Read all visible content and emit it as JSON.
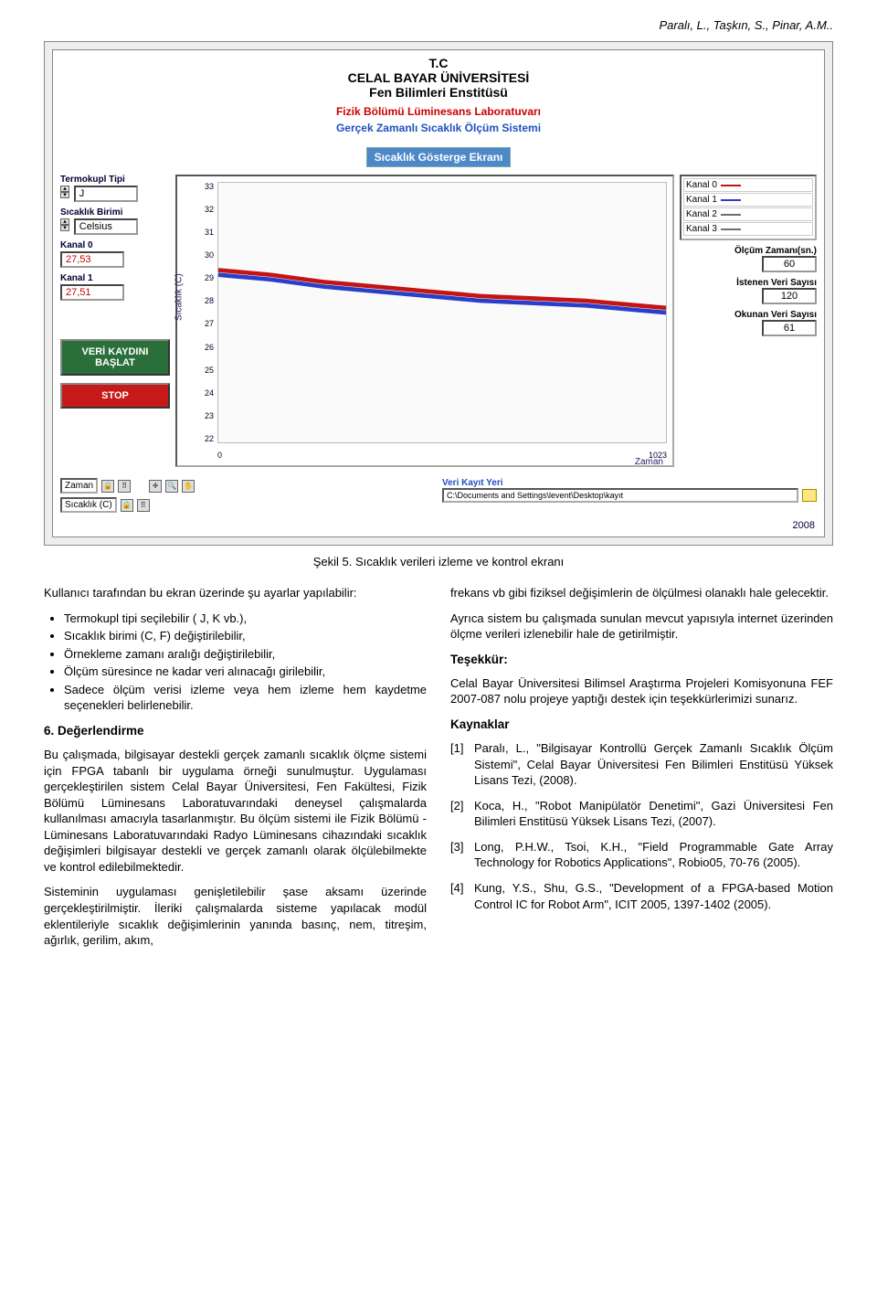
{
  "header": {
    "running": "Paralı, L., Taşkın, S., Pinar, A.M.."
  },
  "figure": {
    "header": {
      "line1a": "T.C",
      "line1b": "CELAL BAYAR ÜNİVERSİTESİ",
      "line1c": "Fen Bilimleri Enstitüsü",
      "line2": "Fizik Bölümü Lüminesans Laboratuvarı",
      "line3": "Gerçek Zamanlı Sıcaklık Ölçüm Sistemi"
    },
    "titlebar": "Sıcaklık Gösterge  Ekranı",
    "left": {
      "thermocouple_label": "Termokupl Tipi",
      "thermocouple_value": "J",
      "unit_label": "Sıcaklık Birimi",
      "unit_value": "Celsius",
      "ch0_label": "Kanal 0",
      "ch0_value": "27,53",
      "ch1_label": "Kanal 1",
      "ch1_value": "27,51",
      "start_btn": "VERİ KAYDINI BAŞLAT",
      "stop_btn": "STOP"
    },
    "graph": {
      "y_label": "Sıcaklık (C)",
      "y_ticks": [
        "33",
        "32",
        "31",
        "30",
        "29",
        "28",
        "27",
        "26",
        "25",
        "24",
        "23",
        "22"
      ],
      "x_ticks": [
        "0",
        "1023"
      ],
      "x_label": "Zaman"
    },
    "right": {
      "legend": [
        {
          "name": "Kanal 0",
          "color": "#c41414"
        },
        {
          "name": "Kanal 1",
          "color": "#2a3fc9"
        },
        {
          "name": "Kanal 2",
          "color": "#6e6e6e"
        },
        {
          "name": "Kanal 3",
          "color": "#6e6e6e"
        }
      ],
      "time_label": "Ölçüm Zamanı(sn.)",
      "time_value": "60",
      "wanted_label": "İstenen Veri Sayısı",
      "wanted_value": "120",
      "read_label": "Okunan Veri Sayısı",
      "read_value": "61"
    },
    "footer": {
      "x_sel_label": "Zaman",
      "y_sel_label": "Sıcaklık (C)",
      "icon1": "🔒",
      "icon2": "⠿",
      "save_label": "Veri Kayıt Yeri",
      "save_path": "C:\\Documents and Settings\\levent\\Desktop\\kayıt",
      "year": "2008"
    },
    "caption": "Şekil 5. Sıcaklık verileri izleme ve kontrol ekranı"
  },
  "chart_data": {
    "type": "line",
    "title": "Sıcaklık Gösterge Ekranı",
    "xlabel": "Zaman",
    "ylabel": "Sıcaklık (C)",
    "xlim": [
      0,
      1023
    ],
    "ylim": [
      22,
      33
    ],
    "y_ticks": [
      22,
      23,
      24,
      25,
      26,
      27,
      28,
      29,
      30,
      31,
      32,
      33
    ],
    "series": [
      {
        "name": "Kanal 0",
        "color": "#c41414",
        "values_approx": [
          [
            0,
            29.3
          ],
          [
            120,
            29.1
          ],
          [
            240,
            28.8
          ],
          [
            360,
            28.6
          ],
          [
            480,
            28.4
          ],
          [
            600,
            28.2
          ],
          [
            720,
            28.1
          ],
          [
            840,
            28.0
          ],
          [
            960,
            27.8
          ],
          [
            1023,
            27.7
          ]
        ]
      },
      {
        "name": "Kanal 1",
        "color": "#2a3fc9",
        "values_approx": [
          [
            0,
            29.1
          ],
          [
            120,
            28.9
          ],
          [
            240,
            28.6
          ],
          [
            360,
            28.4
          ],
          [
            480,
            28.2
          ],
          [
            600,
            28.0
          ],
          [
            720,
            27.9
          ],
          [
            840,
            27.8
          ],
          [
            960,
            27.6
          ],
          [
            1023,
            27.5
          ]
        ]
      }
    ]
  },
  "body": {
    "left": {
      "p1": "Kullanıcı tarafından bu ekran üzerinde şu ayarlar yapılabilir:",
      "li1": "Termokupl tipi seçilebilir ( J, K vb.),",
      "li2": "Sıcaklık birimi (C, F) değiştirilebilir,",
      "li3": "Örnekleme zamanı aralığı değiştirilebilir,",
      "li4": "Ölçüm süresince ne kadar veri alınacağı girilebilir,",
      "li5": "Sadece ölçüm verisi izleme veya hem izleme hem kaydetme seçenekleri belirlenebilir.",
      "h6": "6. Değerlendirme",
      "p2": "Bu çalışmada, bilgisayar destekli gerçek zamanlı sıcaklık ölçme sistemi için FPGA tabanlı bir uygulama örneği sunulmuştur. Uygulaması gerçekleştirilen sistem Celal Bayar Üniversitesi, Fen Fakültesi, Fizik Bölümü Lüminesans Laboratuvarındaki deneysel çalışmalarda kullanılması amacıyla tasarlanmıştır. Bu ölçüm sistemi ile Fizik Bölümü - Lüminesans Laboratuvarındaki Radyo Lüminesans cihazındaki sıcaklık değişimleri bilgisayar destekli ve gerçek zamanlı olarak ölçülebilmekte ve kontrol edilebilmektedir.",
      "p3": "Sisteminin uygulaması genişletilebilir şase aksamı üzerinde gerçekleştirilmiştir. İleriki çalışmalarda sisteme yapılacak modül eklentileriyle sıcaklık değişimlerinin yanında basınç, nem, titreşim, ağırlık, gerilim, akım,"
    },
    "right": {
      "p1": "frekans vb gibi fiziksel değişimlerin de ölçülmesi olanaklı hale gelecektir.",
      "p2": "Ayrıca sistem bu çalışmada sunulan mevcut yapısıyla internet üzerinden ölçme verileri izlenebilir hale de getirilmiştir.",
      "h_thanks": "Teşekkür:",
      "p3": "Celal Bayar Üniversitesi Bilimsel Araştırma Projeleri Komisyonuna FEF 2007-087 nolu projeye yaptığı destek için teşekkürlerimizi sunarız.",
      "h_refs": "Kaynaklar",
      "r1": "Paralı, L., \"Bilgisayar Kontrollü Gerçek Zamanlı Sıcaklık Ölçüm Sistemi\", Celal Bayar Üniversitesi Fen Bilimleri Enstitüsü Yüksek Lisans Tezi, (2008).",
      "r2": "Koca, H., \"Robot Manipülatör Denetimi\", Gazi Üniversitesi Fen Bilimleri Enstitüsü Yüksek Lisans Tezi, (2007).",
      "r3": "Long, P.H.W., Tsoi, K.H., \"Field Programmable Gate Array Technology for Robotics Applications\", Robio05, 70-76 (2005).",
      "r4": "Kung, Y.S., Shu, G.S., \"Development of a FPGA-based Motion Control IC for Robot Arm\", ICIT 2005, 1397-1402 (2005).",
      "n1": "[1]",
      "n2": "[2]",
      "n3": "[3]",
      "n4": "[4]"
    }
  }
}
